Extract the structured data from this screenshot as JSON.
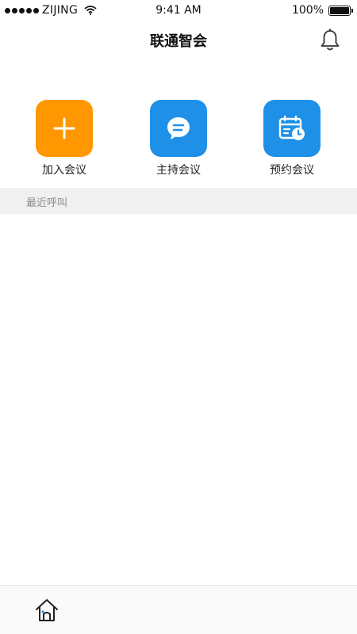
{
  "status_bar": {
    "carrier": "ZIJING",
    "time": "9:41 AM",
    "battery": "100%",
    "battery_level": 1.0,
    "signal_bars": 5
  },
  "header": {
    "title": "联通智会",
    "notification_icon": "bell-icon"
  },
  "actions": [
    {
      "label": "加入会议",
      "icon": "plus-icon",
      "color": "#FF9800"
    },
    {
      "label": "主持会议",
      "icon": "chat-bubble-icon",
      "color": "#1E90E8"
    },
    {
      "label": "预约会议",
      "icon": "calendar-clock-icon",
      "color": "#1E90E8"
    }
  ],
  "recent_calls": {
    "header": "最近呼叫",
    "items": []
  },
  "tab_bar": {
    "items": [
      {
        "icon": "home-icon",
        "active": true
      }
    ]
  },
  "colors": {
    "accent_blue": "#1E90E8",
    "accent_orange": "#FF9800",
    "section_bg": "#F0F0F0"
  }
}
